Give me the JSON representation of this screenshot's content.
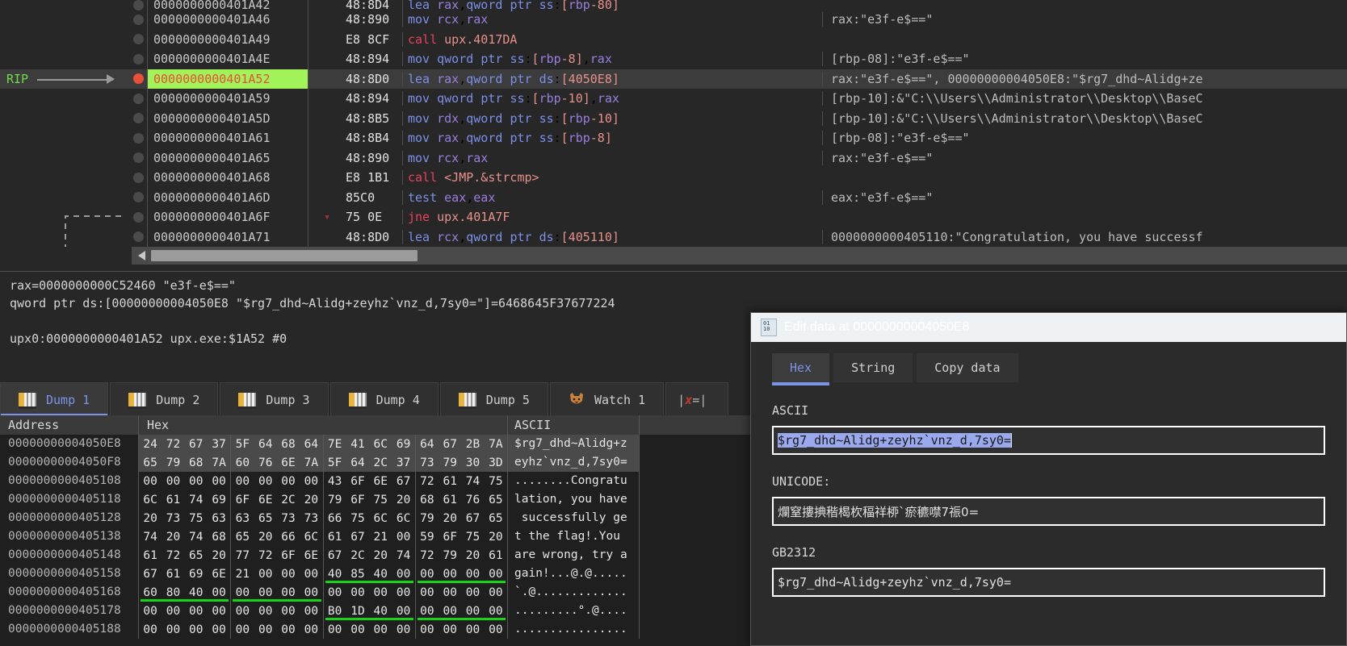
{
  "disasm": {
    "rip_label": "RIP",
    "rows": [
      {
        "addr": "0000000000401A42",
        "bytes": "48:8D4",
        "jmp": "",
        "mnem": "lea",
        "mclass": "kw",
        "ops": "rax,qword ptr ss:[rbp-80]",
        "cmt": "",
        "bp": false,
        "cut": true
      },
      {
        "addr": "0000000000401A46",
        "bytes": "48:890",
        "jmp": "",
        "mnem": "mov",
        "mclass": "kw",
        "ops": "rcx,rax",
        "cmt": "rax:\"e3f-e$==\"",
        "bp": false
      },
      {
        "addr": "0000000000401A49",
        "bytes": "E8 8CF",
        "jmp": "",
        "mnem": "call",
        "mclass": "call",
        "ops": "upx.4017DA",
        "cmt": "",
        "bp": false
      },
      {
        "addr": "0000000000401A4E",
        "bytes": "48:894",
        "jmp": "",
        "mnem": "mov",
        "mclass": "kw",
        "ops": "qword ptr ss:[rbp-8],rax",
        "cmt": "[rbp-08]:\"e3f-e$==\"",
        "bp": false
      },
      {
        "addr": "0000000000401A52",
        "bytes": "48:8D0",
        "jmp": "",
        "mnem": "lea",
        "mclass": "kw",
        "ops": "rax,qword ptr ds:[4050E8]",
        "cmt": "rax:\"e3f-e$==\", 00000000004050E8:\"$rg7_dhd~Alidg+ze",
        "bp": true,
        "current": true
      },
      {
        "addr": "0000000000401A59",
        "bytes": "48:894",
        "jmp": "",
        "mnem": "mov",
        "mclass": "kw",
        "ops": "qword ptr ss:[rbp-10],rax",
        "cmt": "[rbp-10]:&\"C:\\\\Users\\\\Administrator\\\\Desktop\\\\BaseC",
        "bp": false
      },
      {
        "addr": "0000000000401A5D",
        "bytes": "48:8B5",
        "jmp": "",
        "mnem": "mov",
        "mclass": "kw",
        "ops": "rdx,qword ptr ss:[rbp-10]",
        "cmt": "[rbp-10]:&\"C:\\\\Users\\\\Administrator\\\\Desktop\\\\BaseC",
        "bp": false
      },
      {
        "addr": "0000000000401A61",
        "bytes": "48:8B4",
        "jmp": "",
        "mnem": "mov",
        "mclass": "kw",
        "ops": "rax,qword ptr ss:[rbp-8]",
        "cmt": "[rbp-08]:\"e3f-e$==\"",
        "bp": false
      },
      {
        "addr": "0000000000401A65",
        "bytes": "48:890",
        "jmp": "",
        "mnem": "mov",
        "mclass": "kw",
        "ops": "rcx,rax",
        "cmt": "rax:\"e3f-e$==\"",
        "bp": false
      },
      {
        "addr": "0000000000401A68",
        "bytes": "E8 1B1",
        "jmp": "",
        "mnem": "call",
        "mclass": "call",
        "ops": "<JMP.&strcmp>",
        "cmt": "",
        "bp": false
      },
      {
        "addr": "0000000000401A6D",
        "bytes": "85C0",
        "jmp": "",
        "mnem": "test",
        "mclass": "kw",
        "ops": "eax,eax",
        "cmt": "eax:\"e3f-e$==\"",
        "bp": false
      },
      {
        "addr": "0000000000401A6F",
        "bytes": "75 0E",
        "jmp": "v",
        "mnem": "jne",
        "mclass": "jmp",
        "ops": "upx.401A7F",
        "cmt": "",
        "bp": false
      },
      {
        "addr": "0000000000401A71",
        "bytes": "48:8D0",
        "jmp": "",
        "mnem": "lea",
        "mclass": "kw",
        "ops": "rcx,qword ptr ds:[405110]",
        "cmt": "0000000000405110:\"Congratulation, you have successf",
        "bp": false
      }
    ]
  },
  "info": {
    "line1": "rax=0000000000C52460 \"e3f-e$==\"",
    "line2": "qword ptr ds:[00000000004050E8 \"$rg7_dhd~Alidg+zeyhz`vnz_d,7sy0=\"]=6468645F37677224",
    "line3": "upx0:0000000000401A52 upx.exe:$1A52 #0"
  },
  "tabs": [
    {
      "label": "Dump 1",
      "icon": "dump-icon",
      "active": true
    },
    {
      "label": "Dump 2",
      "icon": "dump-icon",
      "active": false
    },
    {
      "label": "Dump 3",
      "icon": "dump-icon",
      "active": false
    },
    {
      "label": "Dump 4",
      "icon": "dump-icon",
      "active": false
    },
    {
      "label": "Dump 5",
      "icon": "dump-icon",
      "active": false
    },
    {
      "label": "Watch 1",
      "icon": "watch-icon",
      "active": false
    },
    {
      "label": "",
      "icon": "locals-icon",
      "active": false
    }
  ],
  "dump": {
    "headers": {
      "address": "Address",
      "hex": "Hex",
      "ascii": "ASCII"
    },
    "rows": [
      {
        "addr": "00000000004050E8",
        "groups": [
          [
            "24",
            "72",
            "67",
            "37"
          ],
          [
            "5F",
            "64",
            "68",
            "64"
          ],
          [
            "7E",
            "41",
            "6C",
            "69"
          ],
          [
            "64",
            "67",
            "2B",
            "7A"
          ]
        ],
        "ascii": "$rg7_dhd~Alidg+z",
        "selected": true,
        "underline": []
      },
      {
        "addr": "00000000004050F8",
        "groups": [
          [
            "65",
            "79",
            "68",
            "7A"
          ],
          [
            "60",
            "76",
            "6E",
            "7A"
          ],
          [
            "5F",
            "64",
            "2C",
            "37"
          ],
          [
            "73",
            "79",
            "30",
            "3D"
          ]
        ],
        "ascii": "eyhz`vnz_d,7sy0=",
        "selected": true,
        "underline": []
      },
      {
        "addr": "0000000000405108",
        "groups": [
          [
            "00",
            "00",
            "00",
            "00"
          ],
          [
            "00",
            "00",
            "00",
            "00"
          ],
          [
            "43",
            "6F",
            "6E",
            "67"
          ],
          [
            "72",
            "61",
            "74",
            "75"
          ]
        ],
        "ascii": "........Congratu",
        "selected": false,
        "underline": []
      },
      {
        "addr": "0000000000405118",
        "groups": [
          [
            "6C",
            "61",
            "74",
            "69"
          ],
          [
            "6F",
            "6E",
            "2C",
            "20"
          ],
          [
            "79",
            "6F",
            "75",
            "20"
          ],
          [
            "68",
            "61",
            "76",
            "65"
          ]
        ],
        "ascii": "lation, you have",
        "selected": false,
        "underline": []
      },
      {
        "addr": "0000000000405128",
        "groups": [
          [
            "20",
            "73",
            "75",
            "63"
          ],
          [
            "63",
            "65",
            "73",
            "73"
          ],
          [
            "66",
            "75",
            "6C",
            "6C"
          ],
          [
            "79",
            "20",
            "67",
            "65"
          ]
        ],
        "ascii": " successfully ge",
        "selected": false,
        "underline": []
      },
      {
        "addr": "0000000000405138",
        "groups": [
          [
            "74",
            "20",
            "74",
            "68"
          ],
          [
            "65",
            "20",
            "66",
            "6C"
          ],
          [
            "61",
            "67",
            "21",
            "00"
          ],
          [
            "59",
            "6F",
            "75",
            "20"
          ]
        ],
        "ascii": "t the flag!.You ",
        "selected": false,
        "underline": []
      },
      {
        "addr": "0000000000405148",
        "groups": [
          [
            "61",
            "72",
            "65",
            "20"
          ],
          [
            "77",
            "72",
            "6F",
            "6E"
          ],
          [
            "67",
            "2C",
            "20",
            "74"
          ],
          [
            "72",
            "79",
            "20",
            "61"
          ]
        ],
        "ascii": "are wrong, try a",
        "selected": false,
        "underline": []
      },
      {
        "addr": "0000000000405158",
        "groups": [
          [
            "67",
            "61",
            "69",
            "6E"
          ],
          [
            "21",
            "00",
            "00",
            "00"
          ],
          [
            "40",
            "85",
            "40",
            "00"
          ],
          [
            "00",
            "00",
            "00",
            "00"
          ]
        ],
        "ascii": "gain!...@.@.....",
        "selected": false,
        "underline": [
          2,
          3
        ]
      },
      {
        "addr": "0000000000405168",
        "groups": [
          [
            "60",
            "80",
            "40",
            "00"
          ],
          [
            "00",
            "00",
            "00",
            "00"
          ],
          [
            "00",
            "00",
            "00",
            "00"
          ],
          [
            "00",
            "00",
            "00",
            "00"
          ]
        ],
        "ascii": "`.@.............",
        "selected": false,
        "underline": [
          0,
          1
        ]
      },
      {
        "addr": "0000000000405178",
        "groups": [
          [
            "00",
            "00",
            "00",
            "00"
          ],
          [
            "00",
            "00",
            "00",
            "00"
          ],
          [
            "B0",
            "1D",
            "40",
            "00"
          ],
          [
            "00",
            "00",
            "00",
            "00"
          ]
        ],
        "ascii": ".........°.@....",
        "selected": false,
        "underline": [
          2,
          3
        ]
      },
      {
        "addr": "0000000000405188",
        "groups": [
          [
            "00",
            "00",
            "00",
            "00"
          ],
          [
            "00",
            "00",
            "00",
            "00"
          ],
          [
            "00",
            "00",
            "00",
            "00"
          ],
          [
            "00",
            "00",
            "00",
            "00"
          ]
        ],
        "ascii": "................",
        "selected": false,
        "underline": []
      }
    ]
  },
  "dialog": {
    "title": "Edit data at 00000000004050E8",
    "tabs": [
      {
        "label": "Hex",
        "active": true
      },
      {
        "label": "String",
        "active": false
      },
      {
        "label": "Copy data",
        "active": false
      }
    ],
    "fields": [
      {
        "label": "ASCII",
        "value": "$rg7_dhd~Alidg+zeyhz`vnz_d,7sy0=",
        "selected": true,
        "cjk": false
      },
      {
        "label": "UNICODE:",
        "value": "爛窒摟捵稭楬杴稫祥桺`瘀穮噤7祳0=",
        "selected": false,
        "cjk": true
      },
      {
        "label": "GB2312",
        "value": "$rg7_dhd~Alidg+zeyhz`vnz_d,7sy0=",
        "selected": false,
        "cjk": false
      }
    ]
  },
  "colors": {
    "current_line_highlight": "#a2f259",
    "rip_red": "#e8503a",
    "accent_blue": "#7b93e8",
    "underline_green": "#18d318",
    "bg": "#272727"
  }
}
